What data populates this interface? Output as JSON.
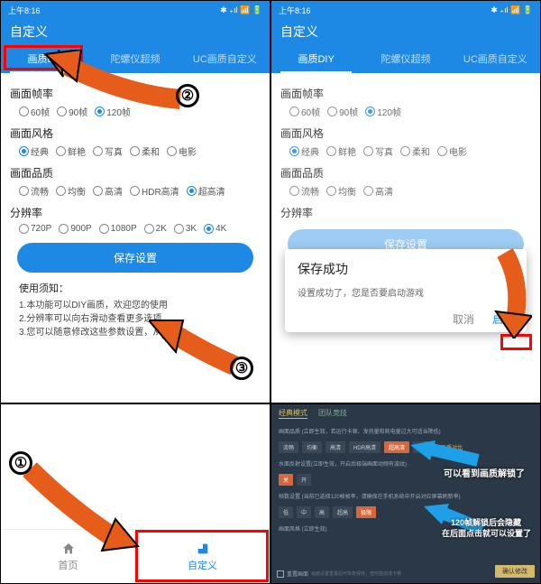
{
  "status": {
    "time": "上午8:16",
    "icons": "⚡ 📶 📶 🔋"
  },
  "header": "自定义",
  "tabs": {
    "diy": "画质DIY",
    "gyro": "陀螺仪超频",
    "uc": "UC画质自定义"
  },
  "sections": {
    "framerate": {
      "title": "画面帧率",
      "options": [
        "60帧",
        "90帧",
        "120帧"
      ],
      "selected": 2
    },
    "style": {
      "title": "画面风格",
      "options": [
        "经典",
        "鲜艳",
        "写真",
        "柔和",
        "电影"
      ],
      "selected": 0
    },
    "quality": {
      "title": "画面品质",
      "options": [
        "流畅",
        "均衡",
        "高清",
        "HDR高清",
        "超高清"
      ],
      "selected": 4
    },
    "resolution": {
      "title": "分辨率",
      "options": [
        "720P",
        "900P",
        "1080P",
        "2K",
        "3K",
        "4K"
      ],
      "selected": 5
    }
  },
  "save_btn": "保存设置",
  "notes": {
    "title": "使用须知：",
    "line1": "1.本功能可以DIY画质，欢迎您的使用",
    "line2": "2.分辨率可以向右滑动查看更多选项",
    "line3": "3.您可以随意修改这些参数设置，从而找"
  },
  "dialog": {
    "title": "保存成功",
    "msg": "设置成功了，您是否要启动游戏",
    "cancel": "取消",
    "launch": "启动"
  },
  "bottomnav": {
    "home": "首页",
    "custom": "自定义"
  },
  "game": {
    "tab1": "经典模式",
    "tab2": "团队竞技",
    "row1_label": "画面品质 (立即生效，若运行卡顿、发热量和耗电量过大可适当降低)",
    "opts1": [
      "流畅",
      "均衡",
      "高清",
      "HDR高清",
      "超高清",
      "极清",
      "画质对比"
    ],
    "row2_label": "水面反射设置(立即生效，开启后极端画面动频有波纹)",
    "opts2": [
      "关",
      "开"
    ],
    "row3_label": "帧数设置 (当前已选择120帧帧率，请确保在手机系统中开启对应屏幕刷新率)",
    "opts3": [
      "低",
      "中",
      "高",
      "超高",
      "极限"
    ],
    "row4_label": "画面风格 (立即生效)",
    "bottom_btn": "重置画面",
    "bottom_text": "画面设置重置后可恢复保存，但可能造成卡顿",
    "confirm": "确认修改"
  },
  "annotations": {
    "note1": "可以看到画质解锁了",
    "note2a": "120帧解锁后会隐藏",
    "note2b": "在后面点击就可以设置了"
  },
  "chart_data": {
    "type": "table",
    "note": "tutorial screenshot composite - no chart data"
  }
}
